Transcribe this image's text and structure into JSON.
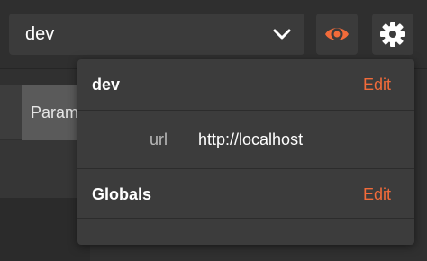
{
  "header": {
    "environment_selected": "dev",
    "icons": {
      "dropdown": "chevron-down-icon",
      "quick_look": "eye-icon",
      "settings": "gear-icon"
    },
    "accent_color": "#f26b3a"
  },
  "background": {
    "tab_label": "Params"
  },
  "dropdown": {
    "environment": {
      "name": "dev",
      "edit_label": "Edit",
      "variables": [
        {
          "key": "url",
          "value": "http://localhost"
        }
      ]
    },
    "globals": {
      "name": "Globals",
      "edit_label": "Edit"
    }
  }
}
